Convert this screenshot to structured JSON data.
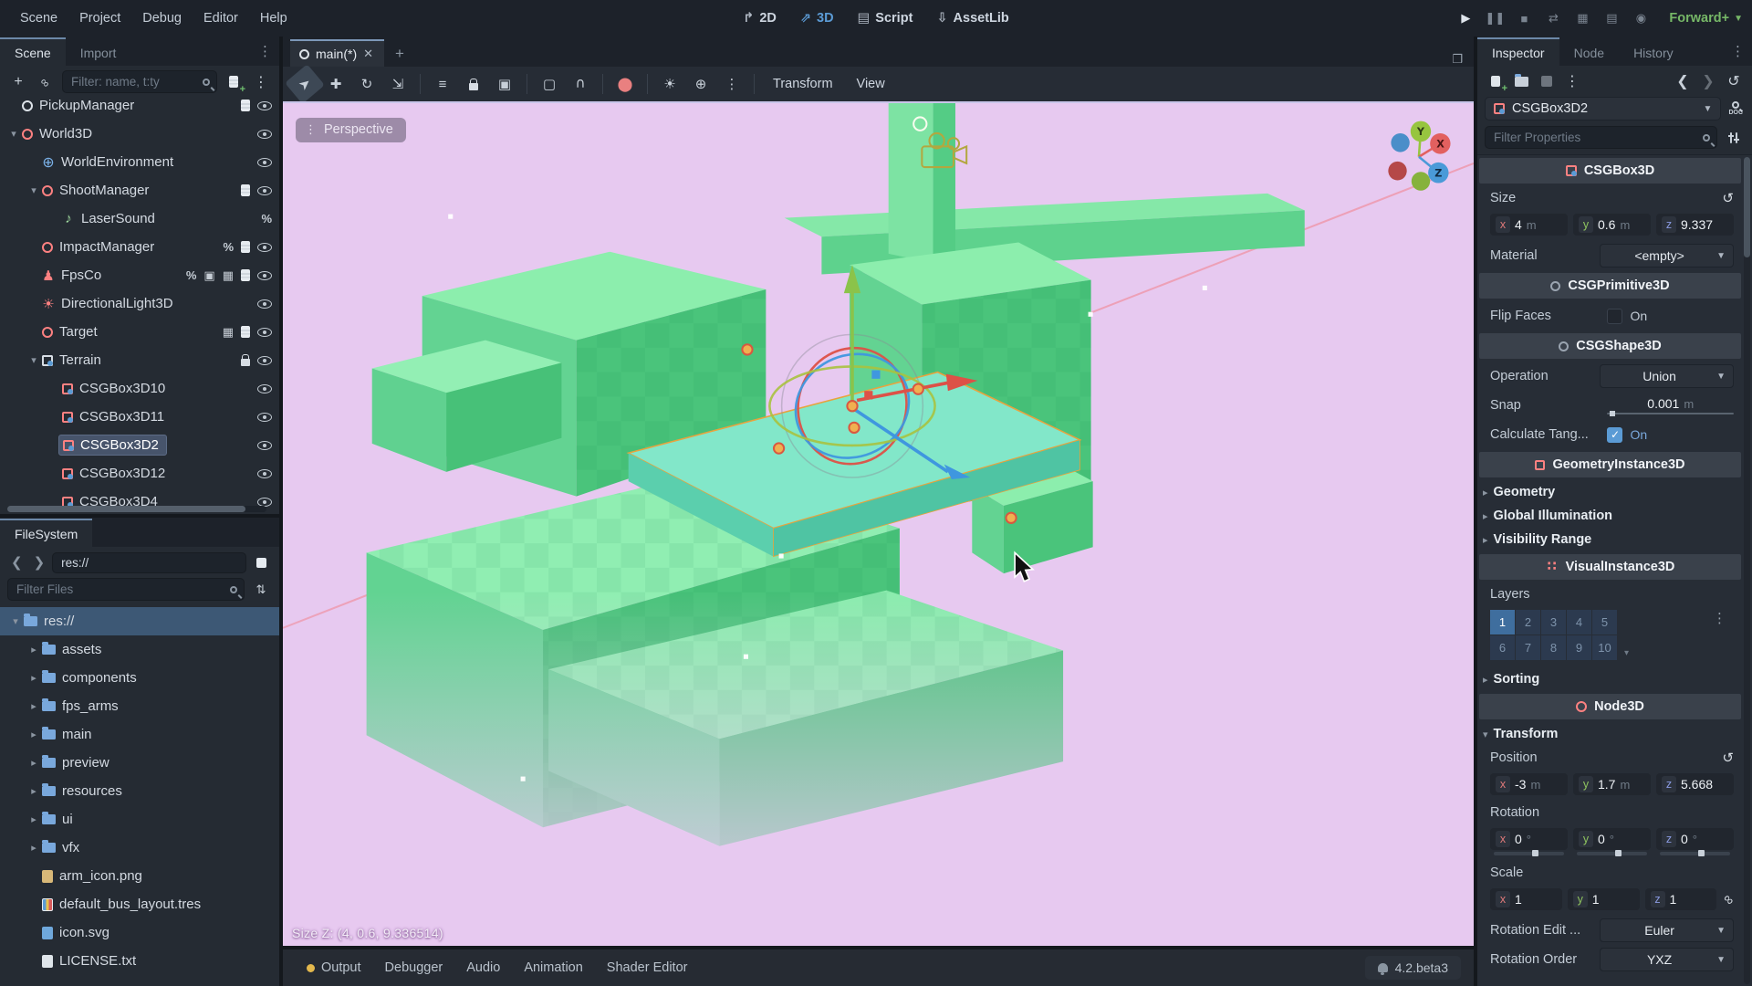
{
  "topbar": {
    "menus": [
      "Scene",
      "Project",
      "Debug",
      "Editor",
      "Help"
    ],
    "context_tabs": [
      {
        "label": "2D",
        "icon": "switch-2d",
        "active": false
      },
      {
        "label": "3D",
        "icon": "switch-3d",
        "active": true
      },
      {
        "label": "Script",
        "icon": "switch-script",
        "active": false
      },
      {
        "label": "AssetLib",
        "icon": "switch-assetlib",
        "active": false
      }
    ],
    "playback": [
      {
        "name": "play-button",
        "icon": "play",
        "dim": false
      },
      {
        "name": "pause-button",
        "icon": "pause",
        "dim": true
      },
      {
        "name": "stop-button",
        "icon": "stop",
        "dim": true
      },
      {
        "name": "remote-debug-button",
        "icon": "remote-debug",
        "dim": true
      },
      {
        "name": "play-scene-button",
        "icon": "play-scene",
        "dim": true
      },
      {
        "name": "play-custom-scene-button",
        "icon": "play-custom",
        "dim": true
      },
      {
        "name": "movie-writer-button",
        "icon": "movie-writer",
        "dim": true
      }
    ],
    "renderer_label": "Forward+"
  },
  "scene_dock": {
    "tabs": [
      {
        "label": "Scene",
        "active": true
      },
      {
        "label": "Import",
        "active": false
      }
    ],
    "filter_placeholder": "Filter: name, t:ty",
    "nodes": [
      {
        "name": "PickupManager",
        "icon": "node",
        "depth": 1,
        "badges": [
          "script"
        ],
        "eye": true,
        "clip": "top"
      },
      {
        "name": "World3D",
        "icon": "node3d",
        "depth": 1,
        "expand": "open",
        "badges": [],
        "eye": true
      },
      {
        "name": "WorldEnvironment",
        "icon": "environment",
        "depth": 2,
        "badges": [],
        "eye": true
      },
      {
        "name": "ShootManager",
        "icon": "node3d",
        "depth": 2,
        "expand": "open",
        "badges": [
          "script"
        ],
        "eye": true
      },
      {
        "name": "LaserSound",
        "icon": "audio",
        "depth": 3,
        "badges": [
          "percent"
        ],
        "eye": false
      },
      {
        "name": "ImpactManager",
        "icon": "node3d",
        "depth": 2,
        "badges": [
          "percent",
          "script"
        ],
        "eye": true
      },
      {
        "name": "FpsCo",
        "icon": "character",
        "depth": 2,
        "badges": [
          "percent",
          "slot",
          "movie",
          "script"
        ],
        "eye": true
      },
      {
        "name": "DirectionalLight3D",
        "icon": "light",
        "depth": 2,
        "badges": [],
        "eye": true
      },
      {
        "name": "Target",
        "icon": "node3d",
        "depth": 2,
        "badges": [
          "movie",
          "script"
        ],
        "eye": true
      },
      {
        "name": "Terrain",
        "icon": "csgcombiner",
        "depth": 2,
        "expand": "open",
        "badges": [
          "lock"
        ],
        "eye": true
      },
      {
        "name": "CSGBox3D10",
        "icon": "csgbox",
        "depth": 3,
        "badges": [],
        "eye": true
      },
      {
        "name": "CSGBox3D11",
        "icon": "csgbox",
        "depth": 3,
        "badges": [],
        "eye": true
      },
      {
        "name": "CSGBox3D2",
        "icon": "csgbox",
        "depth": 3,
        "badges": [],
        "eye": true,
        "selected": true
      },
      {
        "name": "CSGBox3D12",
        "icon": "csgbox",
        "depth": 3,
        "badges": [],
        "eye": true
      },
      {
        "name": "CSGBox3D4",
        "icon": "csgbox",
        "depth": 3,
        "badges": [],
        "eye": true,
        "clip": "bottom"
      }
    ]
  },
  "filesystem_dock": {
    "tab": "FileSystem",
    "path": "res://",
    "filter_placeholder": "Filter Files",
    "items": [
      {
        "name": "res://",
        "icon": "folder",
        "depth": 0,
        "expand": "open",
        "selected": true
      },
      {
        "name": "assets",
        "icon": "folder",
        "depth": 1,
        "expand": "closed"
      },
      {
        "name": "components",
        "icon": "folder",
        "depth": 1,
        "expand": "closed"
      },
      {
        "name": "fps_arms",
        "icon": "folder",
        "depth": 1,
        "expand": "closed"
      },
      {
        "name": "main",
        "icon": "folder",
        "depth": 1,
        "expand": "closed"
      },
      {
        "name": "preview",
        "icon": "folder",
        "depth": 1,
        "expand": "closed"
      },
      {
        "name": "resources",
        "icon": "folder",
        "depth": 1,
        "expand": "closed"
      },
      {
        "name": "ui",
        "icon": "folder",
        "depth": 1,
        "expand": "closed"
      },
      {
        "name": "vfx",
        "icon": "folder",
        "depth": 1,
        "expand": "closed"
      },
      {
        "name": "arm_icon.png",
        "icon": "file-png",
        "depth": 1
      },
      {
        "name": "default_bus_layout.tres",
        "icon": "file-tres",
        "depth": 1
      },
      {
        "name": "icon.svg",
        "icon": "file-svg",
        "depth": 1
      },
      {
        "name": "LICENSE.txt",
        "icon": "file-txt",
        "depth": 1
      }
    ]
  },
  "viewport": {
    "tab_label": "main(*)",
    "toolbar_menus": [
      "Transform",
      "View"
    ],
    "perspective_label": "Perspective",
    "status_text": "Size Z: (4, 0.6, 9.336514)"
  },
  "inspector": {
    "tabs": [
      {
        "label": "Inspector",
        "active": true
      },
      {
        "label": "Node",
        "active": false
      },
      {
        "label": "History",
        "active": false
      }
    ],
    "selected_object": "CSGBox3D2",
    "filter_placeholder": "Filter Properties",
    "rows": [
      {
        "type": "header",
        "label": "CSGBox3D",
        "icon": "csgbox"
      },
      {
        "type": "label",
        "label": "Size",
        "revert": true
      },
      {
        "type": "vector3",
        "cells": [
          {
            "axis": "x",
            "value": "4",
            "unit": "m"
          },
          {
            "axis": "y",
            "value": "0.6",
            "unit": "m"
          },
          {
            "axis": "z",
            "value": "9.337",
            "unit": ""
          }
        ]
      },
      {
        "type": "dropdown",
        "label": "Material",
        "value": "<empty>"
      },
      {
        "type": "header",
        "label": "CSGPrimitive3D",
        "icon": "circle"
      },
      {
        "type": "check",
        "label": "Flip Faces",
        "checked": false,
        "text": "On"
      },
      {
        "type": "header",
        "label": "CSGShape3D",
        "icon": "circle"
      },
      {
        "type": "dropdown",
        "label": "Operation",
        "value": "Union"
      },
      {
        "type": "slider",
        "label": "Snap",
        "value": "0.001",
        "unit": "m"
      },
      {
        "type": "check",
        "label": "Calculate Tang...",
        "checked": true,
        "text": "On"
      },
      {
        "type": "header",
        "label": "GeometryInstance3D",
        "icon": "geometry"
      },
      {
        "type": "group",
        "label": "Geometry",
        "open": false
      },
      {
        "type": "group",
        "label": "Global Illumination",
        "open": false
      },
      {
        "type": "group",
        "label": "Visibility Range",
        "open": false
      },
      {
        "type": "header",
        "label": "VisualInstance3D",
        "icon": "visual"
      },
      {
        "type": "label",
        "label": "Layers",
        "revert": false
      },
      {
        "type": "layers",
        "cells": [
          "1",
          "2",
          "3",
          "4",
          "5",
          "6",
          "7",
          "8",
          "9",
          "10"
        ],
        "active": [
          "1"
        ]
      },
      {
        "type": "group",
        "label": "Sorting",
        "open": false
      },
      {
        "type": "header",
        "label": "Node3D",
        "icon": "node3d"
      },
      {
        "type": "group",
        "label": "Transform",
        "open": true
      },
      {
        "type": "label",
        "label": "Position",
        "revert": true
      },
      {
        "type": "vector3",
        "cells": [
          {
            "axis": "x",
            "value": "-3",
            "unit": "m"
          },
          {
            "axis": "y",
            "value": "1.7",
            "unit": "m"
          },
          {
            "axis": "z",
            "value": "5.668",
            "unit": ""
          }
        ]
      },
      {
        "type": "label",
        "label": "Rotation",
        "revert": false
      },
      {
        "type": "vector3-slider",
        "cells": [
          {
            "axis": "x",
            "value": "0",
            "unit": "°"
          },
          {
            "axis": "y",
            "value": "0",
            "unit": "°"
          },
          {
            "axis": "z",
            "value": "0",
            "unit": "°"
          }
        ]
      },
      {
        "type": "label",
        "label": "Scale",
        "revert": false
      },
      {
        "type": "vector3",
        "link": true,
        "cells": [
          {
            "axis": "x",
            "value": "1",
            "unit": ""
          },
          {
            "axis": "y",
            "value": "1",
            "unit": ""
          },
          {
            "axis": "z",
            "value": "1",
            "unit": ""
          }
        ]
      },
      {
        "type": "dropdown",
        "label": "Rotation Edit ...",
        "value": "Euler"
      },
      {
        "type": "dropdown",
        "label": "Rotation Order",
        "value": "YXZ"
      }
    ]
  },
  "bottom_bar": {
    "tabs": [
      "Output",
      "Debugger",
      "Audio",
      "Animation",
      "Shader Editor"
    ],
    "version": "4.2.beta3"
  }
}
